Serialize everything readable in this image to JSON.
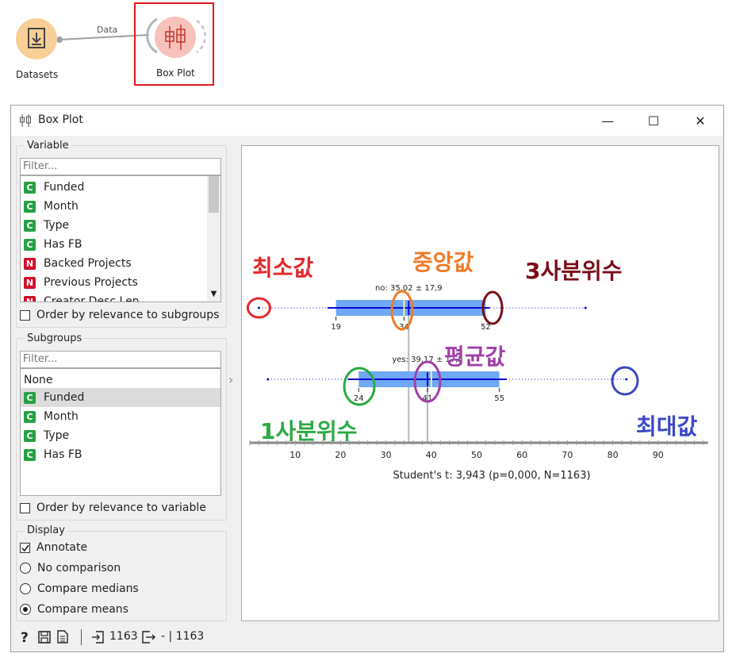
{
  "canvas": {
    "node_datasets": {
      "label": "Datasets",
      "color": "#f8cf97"
    },
    "node_boxplot": {
      "label": "Box Plot",
      "color": "#f7c1bc"
    },
    "link_label": "Data",
    "highlight_color": "#e41a1c"
  },
  "window": {
    "title": "Box Plot",
    "controls": {
      "minimize": "—",
      "maximize": "☐",
      "close": "✕"
    }
  },
  "variable": {
    "title": "Variable",
    "filter_placeholder": "Filter...",
    "items": [
      {
        "type": "C",
        "label": "Funded"
      },
      {
        "type": "C",
        "label": "Month"
      },
      {
        "type": "C",
        "label": "Type"
      },
      {
        "type": "C",
        "label": "Has FB"
      },
      {
        "type": "N",
        "label": "Backed Projects"
      },
      {
        "type": "N",
        "label": "Previous Projects"
      },
      {
        "type": "N",
        "label": "Creator Desc Len"
      }
    ],
    "order_label": "Order by relevance to subgroups"
  },
  "subgroups": {
    "title": "Subgroups",
    "filter_placeholder": "Filter...",
    "none_label": "None",
    "items": [
      {
        "type": "C",
        "label": "Funded"
      },
      {
        "type": "C",
        "label": "Month"
      },
      {
        "type": "C",
        "label": "Type"
      },
      {
        "type": "C",
        "label": "Has FB"
      }
    ],
    "order_label": "Order by relevance to variable"
  },
  "display": {
    "title": "Display",
    "annotate": "Annotate",
    "no_comparison": "No comparison",
    "compare_medians": "Compare medians",
    "compare_means": "Compare means"
  },
  "plot": {
    "row_no": {
      "label": "no: 35,02 ± 17,9",
      "q1_label": "19",
      "median_label": "34",
      "q3_label": "52"
    },
    "row_yes": {
      "label": "yes: 39,17 ± 17,5",
      "q1_label": "24",
      "mean_label": "41",
      "q3_label": "55"
    },
    "stat_text": "Student's t: 3,943 (p=0,000, N=1163)"
  },
  "chart_data": {
    "type": "box",
    "categories": [
      "no",
      "yes"
    ],
    "series": [
      {
        "name": "no",
        "min": 2,
        "q1": 19,
        "median": 34,
        "q3": 52,
        "max": 74,
        "mean": 35.02,
        "sd": 17.9
      },
      {
        "name": "yes",
        "min": 4,
        "q1": 24,
        "median": 40,
        "q3": 55,
        "max": 83,
        "mean": 39.17,
        "sd": 17.5
      }
    ],
    "x_ticks": [
      10,
      20,
      30,
      40,
      50,
      60,
      70,
      80,
      90
    ],
    "xlim": [
      0,
      101
    ],
    "box_color": "#6fa8f4",
    "line_color": "#0a0ad0"
  },
  "annotations": {
    "min": {
      "text": "최소값",
      "color": "#e5262b"
    },
    "median": {
      "text": "중앙값",
      "color": "#f07a26"
    },
    "q3": {
      "text": "3사분위수",
      "color": "#7a0c18"
    },
    "mean": {
      "text": "평균값",
      "color": "#a040a8"
    },
    "q1": {
      "text": "1사분위수",
      "color": "#2aaa44"
    },
    "max": {
      "text": "최대값",
      "color": "#3a48c8"
    }
  },
  "statusbar": {
    "input_count": "1163",
    "output_text": "- | 1163"
  }
}
